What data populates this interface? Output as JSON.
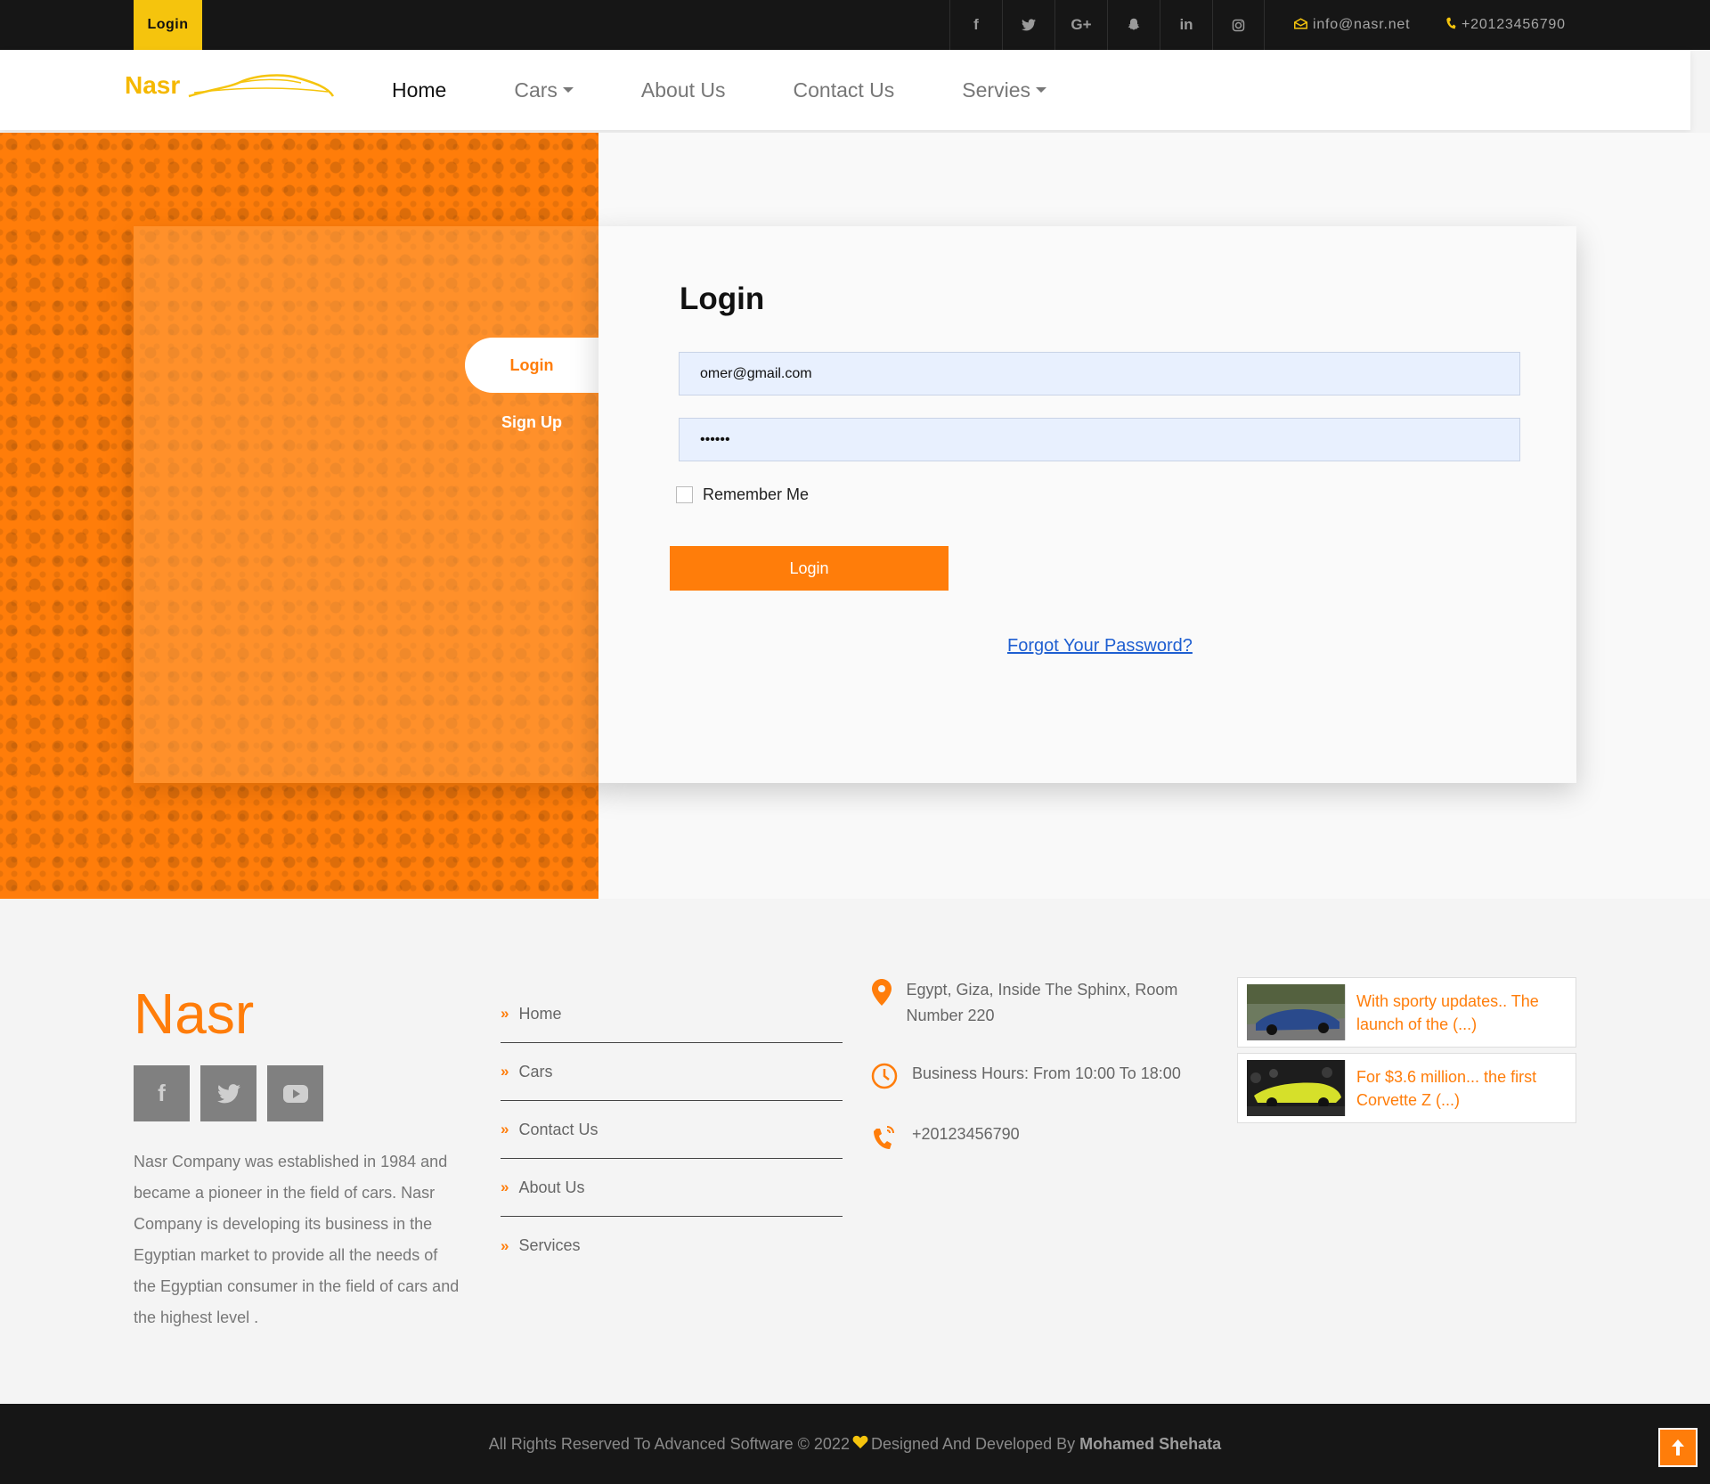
{
  "topbar": {
    "login_label": "Login",
    "social": [
      "f",
      "t",
      "G+",
      "♣",
      "in",
      "◎"
    ],
    "email": "info@nasr.net",
    "phone": "+20123456790"
  },
  "nav": {
    "brand": "Nasr",
    "items": [
      {
        "label": "Home"
      },
      {
        "label": "Cars"
      },
      {
        "label": "About Us"
      },
      {
        "label": "Contact Us"
      },
      {
        "label": "Servies"
      }
    ]
  },
  "login_card": {
    "tab_login": "Login",
    "tab_signup": "Sign Up",
    "title": "Login",
    "email_value": "omer@gmail.com",
    "password_value": "••••••",
    "remember_label": "Remember Me",
    "button_label": "Login",
    "forgot_label": "Forgot Your Password?"
  },
  "footer": {
    "brand": "Nasr",
    "about": "Nasr Company was established in 1984 and became a pioneer in the field of cars. Nasr Company is developing its business in the Egyptian market to provide all the needs of the Egyptian consumer in the field of cars and the highest level .",
    "links": [
      {
        "label": "Home"
      },
      {
        "label": "Cars"
      },
      {
        "label": "Contact Us"
      },
      {
        "label": "About Us"
      },
      {
        "label": "Services"
      }
    ],
    "address": "Egypt, Giza, Inside The Sphinx, Room Number 220",
    "hours": "Business Hours: From 10:00 To 18:00",
    "phone": "+20123456790",
    "news": [
      {
        "text": "With sporty updates.. The launch of the (...)"
      },
      {
        "text": "For $3.6 million... the first Corvette Z (...)"
      }
    ]
  },
  "bottom": {
    "copyright": "All Rights Reserved To Advanced Software © 2022",
    "designed_by": "Designed And Developed By",
    "author": "Mohamed Shehata"
  },
  "colors": {
    "accent": "#ff7d0a",
    "brand_yellow": "#f5c40d",
    "dark": "#161616"
  }
}
